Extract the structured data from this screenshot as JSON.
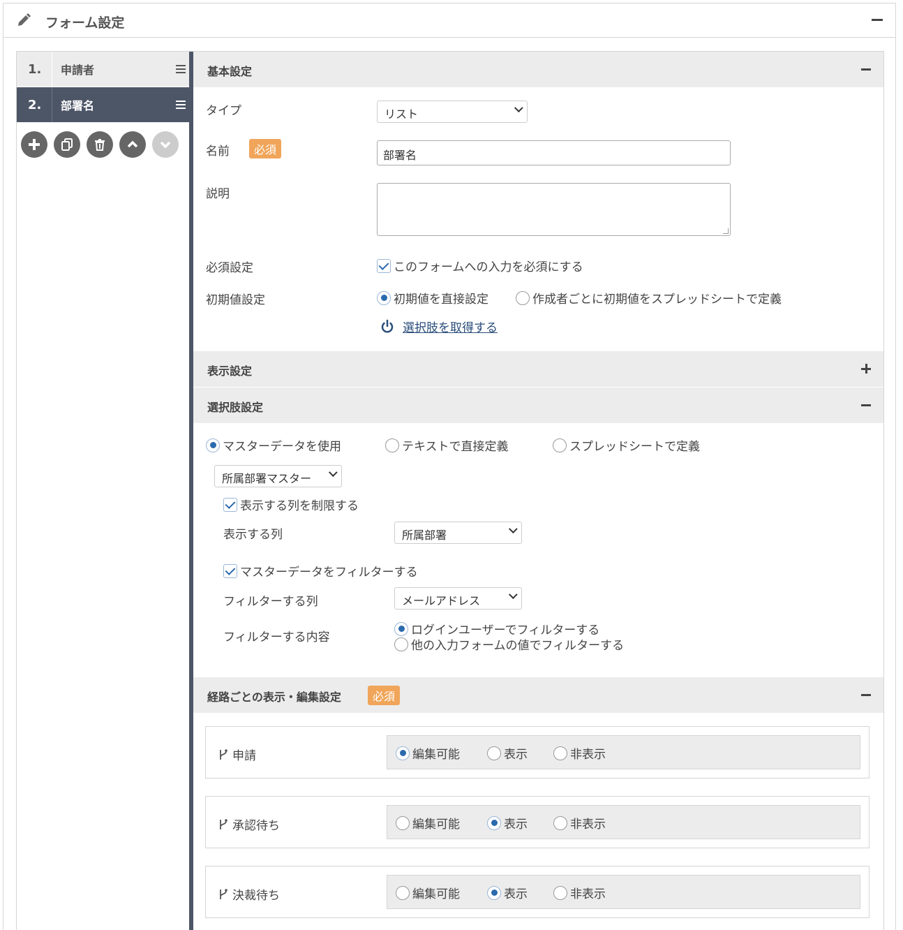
{
  "header": {
    "title": "フォーム設定"
  },
  "form_items": [
    {
      "num": "1.",
      "label": "申請者"
    },
    {
      "num": "2.",
      "label": "部署名"
    }
  ],
  "actions": [
    "add-icon",
    "copy-icon",
    "trash-icon",
    "chevron-up-icon",
    "chevron-down-icon"
  ],
  "basic": {
    "title": "基本設定",
    "type_label": "タイプ",
    "type_value": "リスト",
    "name_label": "名前",
    "required_badge": "必須",
    "name_value": "部署名",
    "desc_label": "説明",
    "required_label": "必須設定",
    "required_check": "このフォームへの入力を必須にする",
    "initial_label": "初期値設定",
    "initial_opt1": "初期値を直接設定",
    "initial_opt2": "作成者ごとに初期値をスプレッドシートで定義",
    "fetch_link": "選択肢を取得する"
  },
  "display": {
    "title": "表示設定"
  },
  "choices": {
    "title": "選択肢設定",
    "opt1": "マスターデータを使用",
    "opt2": "テキストで直接定義",
    "opt3": "スプレッドシートで定義",
    "master_select": "所属部署マスター",
    "limit_check": "表示する列を制限する",
    "col_label": "表示する列",
    "col_value": "所属部署",
    "filter_check": "マスターデータをフィルターする",
    "filter_col_label": "フィルターする列",
    "filter_col_value": "メールアドレス",
    "filter_content_label": "フィルターする内容",
    "filter_opt1": "ログインユーザーでフィルターする",
    "filter_opt2": "他の入力フォームの値でフィルターする"
  },
  "routes": {
    "title": "経路ごとの表示・編集設定",
    "badge": "必須",
    "options": [
      "編集可能",
      "表示",
      "非表示"
    ],
    "items": [
      {
        "label": "申請",
        "selected": "編集可能"
      },
      {
        "label": "承認待ち",
        "selected": "表示"
      },
      {
        "label": "決裁待ち",
        "selected": "表示"
      }
    ]
  },
  "colors": {
    "accent": "#2a6aad",
    "dark_nav": "#4d5667",
    "badge": "#f0a55a",
    "section_bg": "#ececec"
  }
}
